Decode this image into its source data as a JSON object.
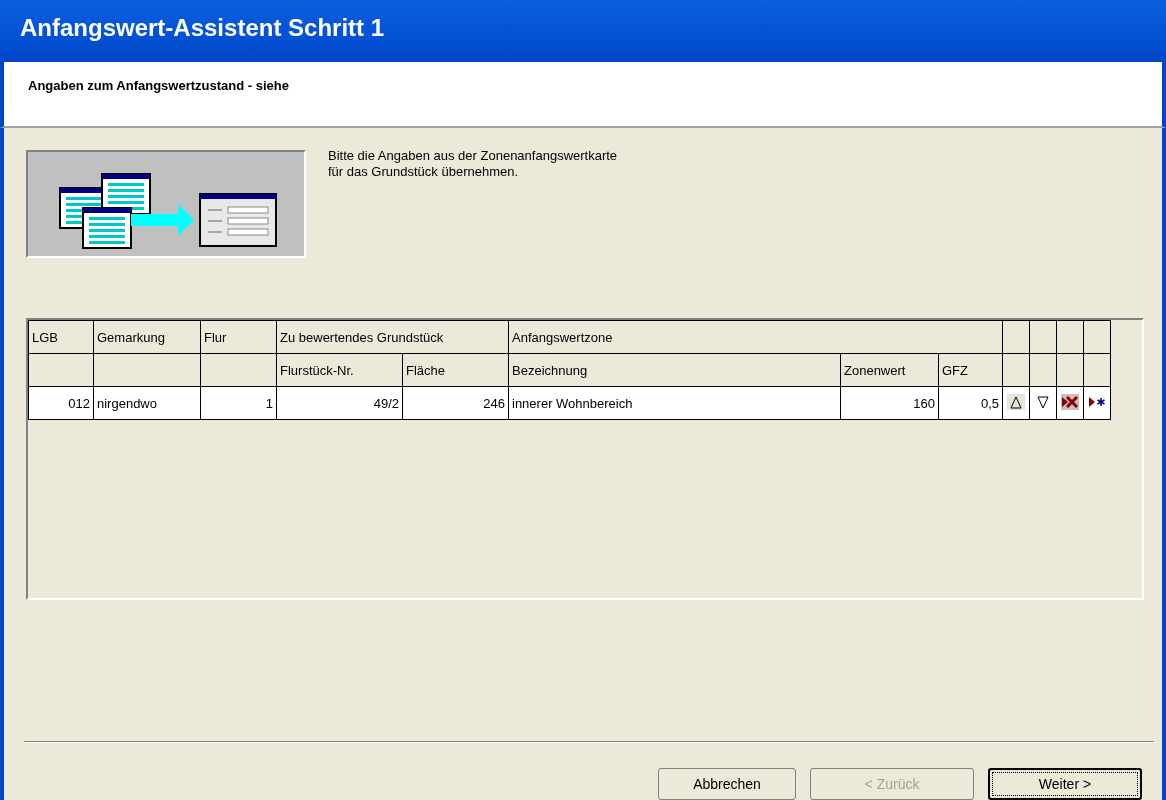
{
  "window": {
    "title": "Anfangswert-Assistent Schritt 1"
  },
  "header": {
    "subtitle": "Angaben zum Anfangswertzustand - siehe"
  },
  "instruction": "Bitte die Angaben aus der Zonenanfangswertkarte für das Grundstück übernehmen.",
  "table": {
    "group_headers": [
      "LGB",
      "Gemarkung",
      "Flur",
      "Zu bewertendes Grundstück",
      "Anfangswertzone"
    ],
    "columns": [
      "",
      "",
      "",
      "Flurstück-Nr.",
      "Fläche",
      "Bezeichnung",
      "Zonenwert",
      "GFZ"
    ],
    "rows": [
      {
        "cells": [
          "012",
          "nirgendwo",
          "1",
          "49/2",
          "246",
          "innerer Wohnbereich",
          "160",
          "0,5"
        ]
      }
    ]
  },
  "buttons": [
    {
      "label": "Abbrechen",
      "disabled": false,
      "default": false
    },
    {
      "label": "< Zurück",
      "disabled": true,
      "default": false
    },
    {
      "label": "Weiter >",
      "disabled": false,
      "default": true
    }
  ]
}
